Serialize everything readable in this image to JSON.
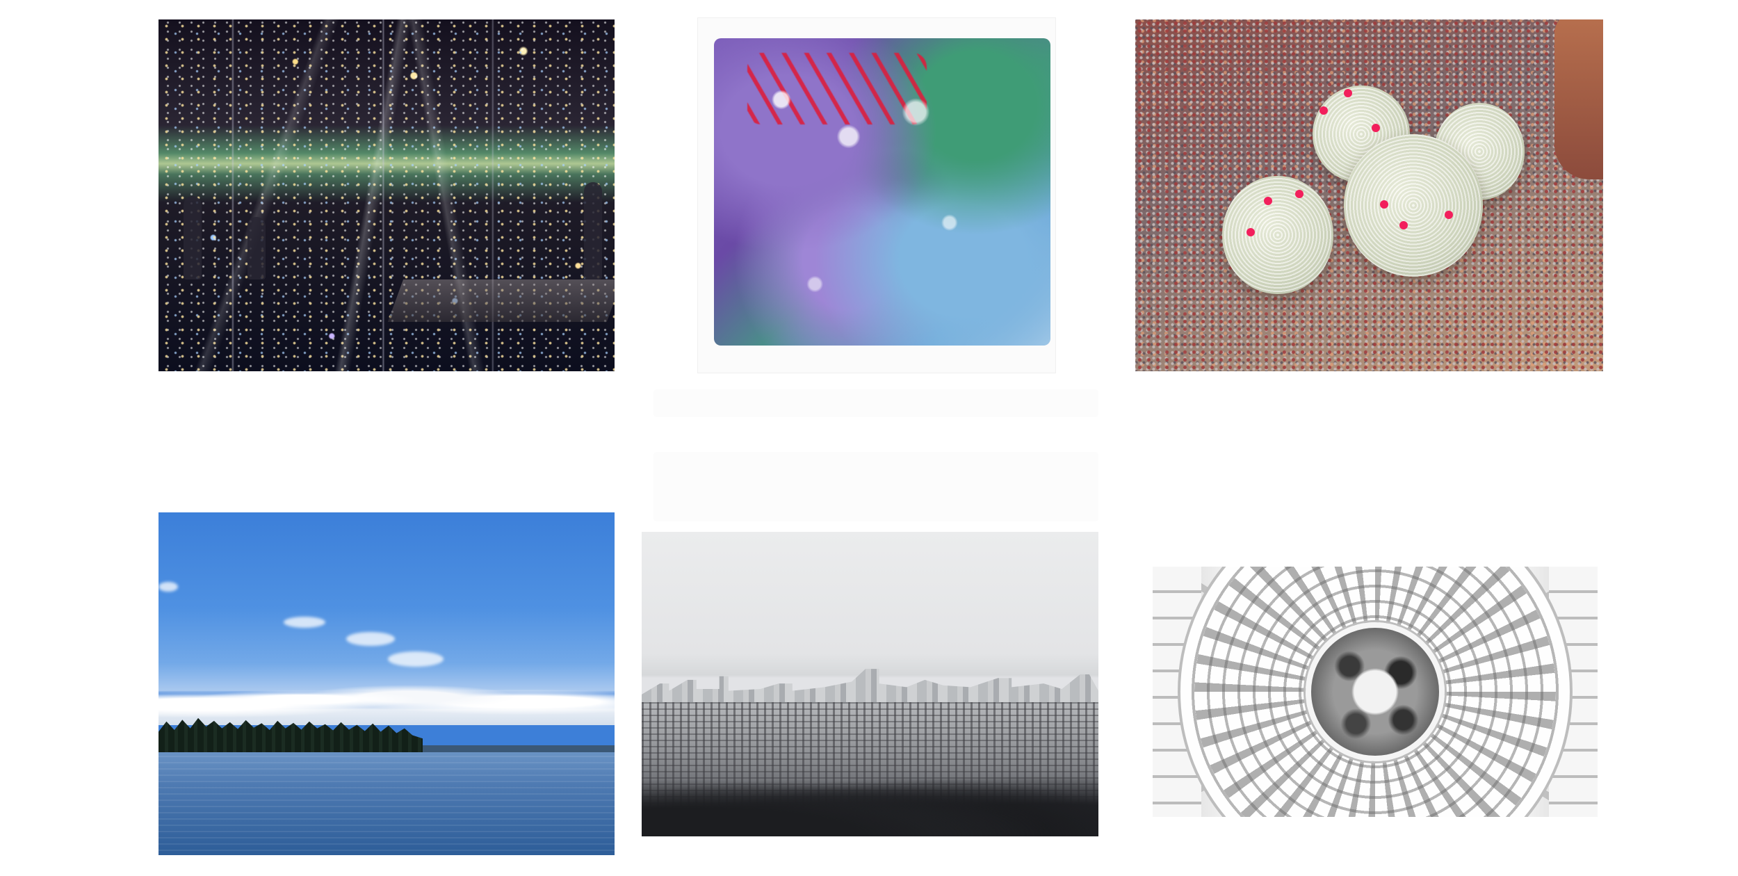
{
  "gallery": {
    "photos": [
      {
        "name": "mirror-room-photo",
        "icon": "photo-icon"
      },
      {
        "name": "resin-sculpture-photo",
        "icon": "photo-icon"
      },
      {
        "name": "cactus-photo",
        "icon": "photo-icon"
      },
      {
        "name": "lake-photo",
        "icon": "photo-icon"
      },
      {
        "name": "city-skyline-photo",
        "icon": "photo-icon"
      },
      {
        "name": "capitol-dome-photo",
        "icon": "photo-icon"
      }
    ]
  },
  "colors": {
    "page_background": "#ffffff"
  }
}
